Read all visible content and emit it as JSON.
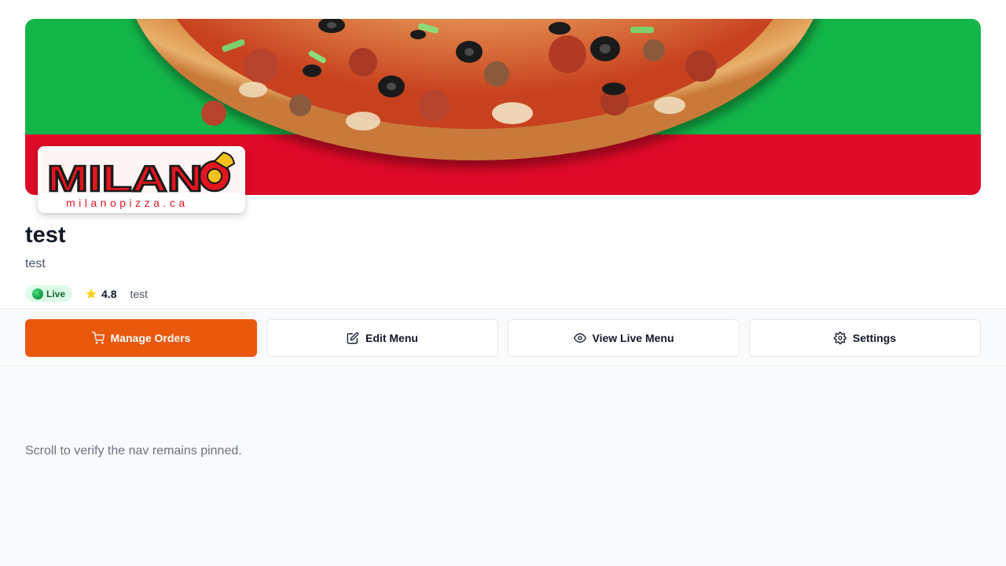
{
  "store": {
    "name": "test",
    "description": "test",
    "status": "Live",
    "rating": "4.8",
    "note": "test"
  },
  "logo": {
    "brand": "MILANO",
    "domain": "milanopizza.ca"
  },
  "nav": {
    "manage_orders": "Manage Orders",
    "edit_menu": "Edit Menu",
    "view_live_menu": "View Live Menu",
    "settings": "Settings"
  },
  "content": {
    "scroll_hint": "Scroll to verify the nav remains pinned."
  },
  "icons": {
    "cart": "cart-icon",
    "edit": "edit-icon",
    "eye": "eye-icon",
    "gear": "gear-icon",
    "star": "star-icon"
  },
  "colors": {
    "accent": "#ea580c",
    "banner_green": "#12b548",
    "banner_red": "#de0a28",
    "live_bg": "#dcfce7",
    "live_text": "#166534",
    "star": "#facc15"
  }
}
